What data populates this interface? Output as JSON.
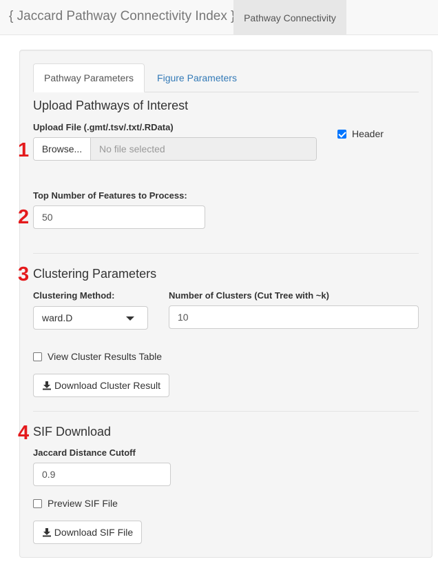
{
  "navbar": {
    "brand": "{ Jaccard Pathway Connectivity Index }",
    "tab": "Pathway Connectivity"
  },
  "tabs": [
    {
      "label": "Pathway Parameters",
      "active": true
    },
    {
      "label": "Figure Parameters",
      "active": false
    }
  ],
  "upload": {
    "heading": "Upload Pathways of Interest",
    "label": "Upload File (.gmt/.tsv/.txt/.RData)",
    "browse_label": "Browse...",
    "file_text": "No file selected",
    "header_label": "Header",
    "header_checked": true
  },
  "features": {
    "label": "Top Number of Features to Process:",
    "value": "50"
  },
  "clustering": {
    "heading": "Clustering Parameters",
    "method_label": "Clustering Method:",
    "method_value": "ward.D",
    "clusters_label": "Number of Clusters (Cut Tree with ~k)",
    "clusters_value": "10",
    "view_table_label": "View Cluster Results Table",
    "view_table_checked": false,
    "download_label": "Download Cluster Result"
  },
  "sif": {
    "heading": "SIF Download",
    "cutoff_label": "Jaccard Distance Cutoff",
    "cutoff_value": "0.9",
    "preview_label": "Preview SIF File",
    "preview_checked": false,
    "download_label": "Download SIF File"
  },
  "annotations": [
    "1",
    "2",
    "3",
    "4"
  ],
  "colors": {
    "annotation": "#e41a1c",
    "link": "#337ab7",
    "checkbox_accent": "#0075ff"
  },
  "icons": {
    "download": "download-icon",
    "caret": "caret-down-icon",
    "checkbox": "checkbox-icon"
  }
}
